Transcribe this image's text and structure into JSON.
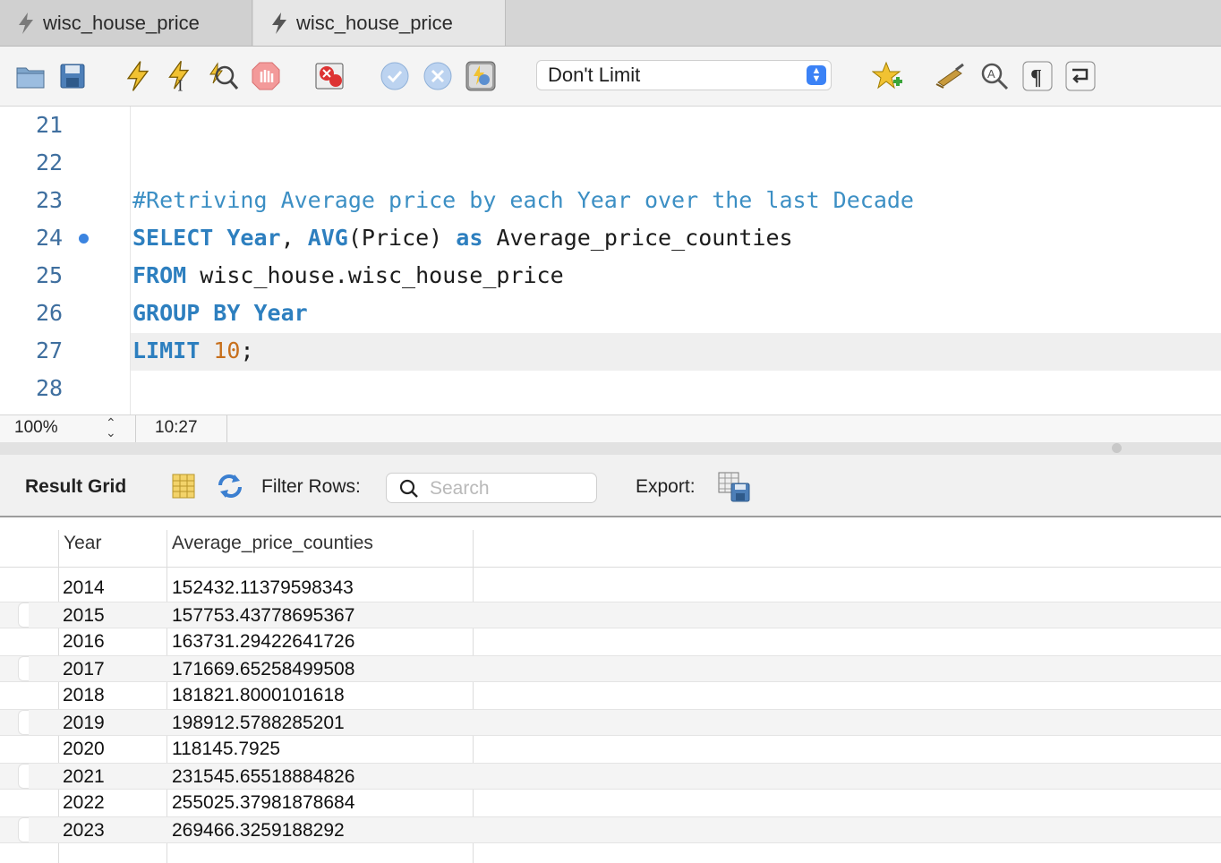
{
  "tabs": [
    {
      "label": "wisc_house_price"
    },
    {
      "label": "wisc_house_price"
    }
  ],
  "toolbar": {
    "icons": [
      "open-folder-icon",
      "save-icon",
      "execute-icon",
      "execute-current-icon",
      "explain-icon",
      "stop-icon",
      "toggle-error-icon",
      "commit-icon",
      "rollback-icon",
      "autocommit-icon",
      "bookmark-icon",
      "beautify-icon",
      "find-icon",
      "invisible-chars-icon",
      "wrap-icon"
    ],
    "limit_value": "Don't Limit"
  },
  "editor": {
    "lines": [
      {
        "num": "21"
      },
      {
        "num": "22"
      },
      {
        "num": "23",
        "comment": "#Retriving Average price by each Year over the last Decade"
      },
      {
        "num": "24",
        "k1": "SELECT",
        "t1": " ",
        "k2": "Year",
        "t2": ", ",
        "k3": "AVG",
        "t3": "(Price) ",
        "k4": "as",
        "t4": " Average_price_counties"
      },
      {
        "num": "25",
        "k1": "FROM",
        "t1": " wisc_house.wisc_house_price"
      },
      {
        "num": "26",
        "k1": "GROUP BY",
        "t1": " ",
        "k2": "Year"
      },
      {
        "num": "27",
        "k1": "LIMIT",
        "t1": " ",
        "n1": "10",
        "t2": ";"
      },
      {
        "num": "28"
      }
    ]
  },
  "status": {
    "zoom": "100%",
    "cursor": "10:27"
  },
  "results": {
    "title": "Result Grid",
    "filter_label": "Filter Rows:",
    "search_placeholder": "Search",
    "export_label": "Export:",
    "columns": [
      "Year",
      "Average_price_counties"
    ],
    "rows": [
      [
        "2014",
        "152432.11379598343"
      ],
      [
        "2015",
        "157753.43778695367"
      ],
      [
        "2016",
        "163731.29422641726"
      ],
      [
        "2017",
        "171669.65258499508"
      ],
      [
        "2018",
        "181821.8000101618"
      ],
      [
        "2019",
        "198912.5788285201"
      ],
      [
        "2020",
        "118145.7925"
      ],
      [
        "2021",
        "231545.65518884826"
      ],
      [
        "2022",
        "255025.37981878684"
      ],
      [
        "2023",
        "269466.3259188292"
      ]
    ]
  }
}
